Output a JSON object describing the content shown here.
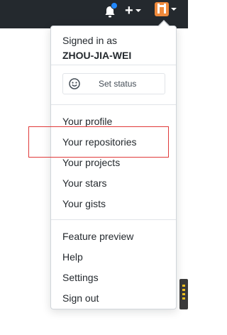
{
  "header": {
    "bell_icon": "bell-icon",
    "plus_icon": "plus-icon",
    "caret_icon": "caret-down-icon",
    "avatar_icon": "avatar",
    "colors": {
      "background": "#24292e",
      "notification_dot": "#2188ff",
      "avatar": "#f08a3c"
    }
  },
  "dropdown": {
    "signed_in_label": "Signed in as",
    "username": "ZHOU-JIA-WEI",
    "set_status": {
      "icon": "smiley-icon",
      "label": "Set status"
    },
    "items": [
      {
        "label": "Your profile"
      },
      {
        "label": "Your repositories"
      },
      {
        "label": "Your projects"
      },
      {
        "label": "Your stars"
      },
      {
        "label": "Your gists"
      },
      {
        "label": "Feature preview"
      },
      {
        "label": "Help"
      },
      {
        "label": "Settings"
      },
      {
        "label": "Sign out"
      }
    ],
    "highlight_color": "#e03a3a"
  }
}
